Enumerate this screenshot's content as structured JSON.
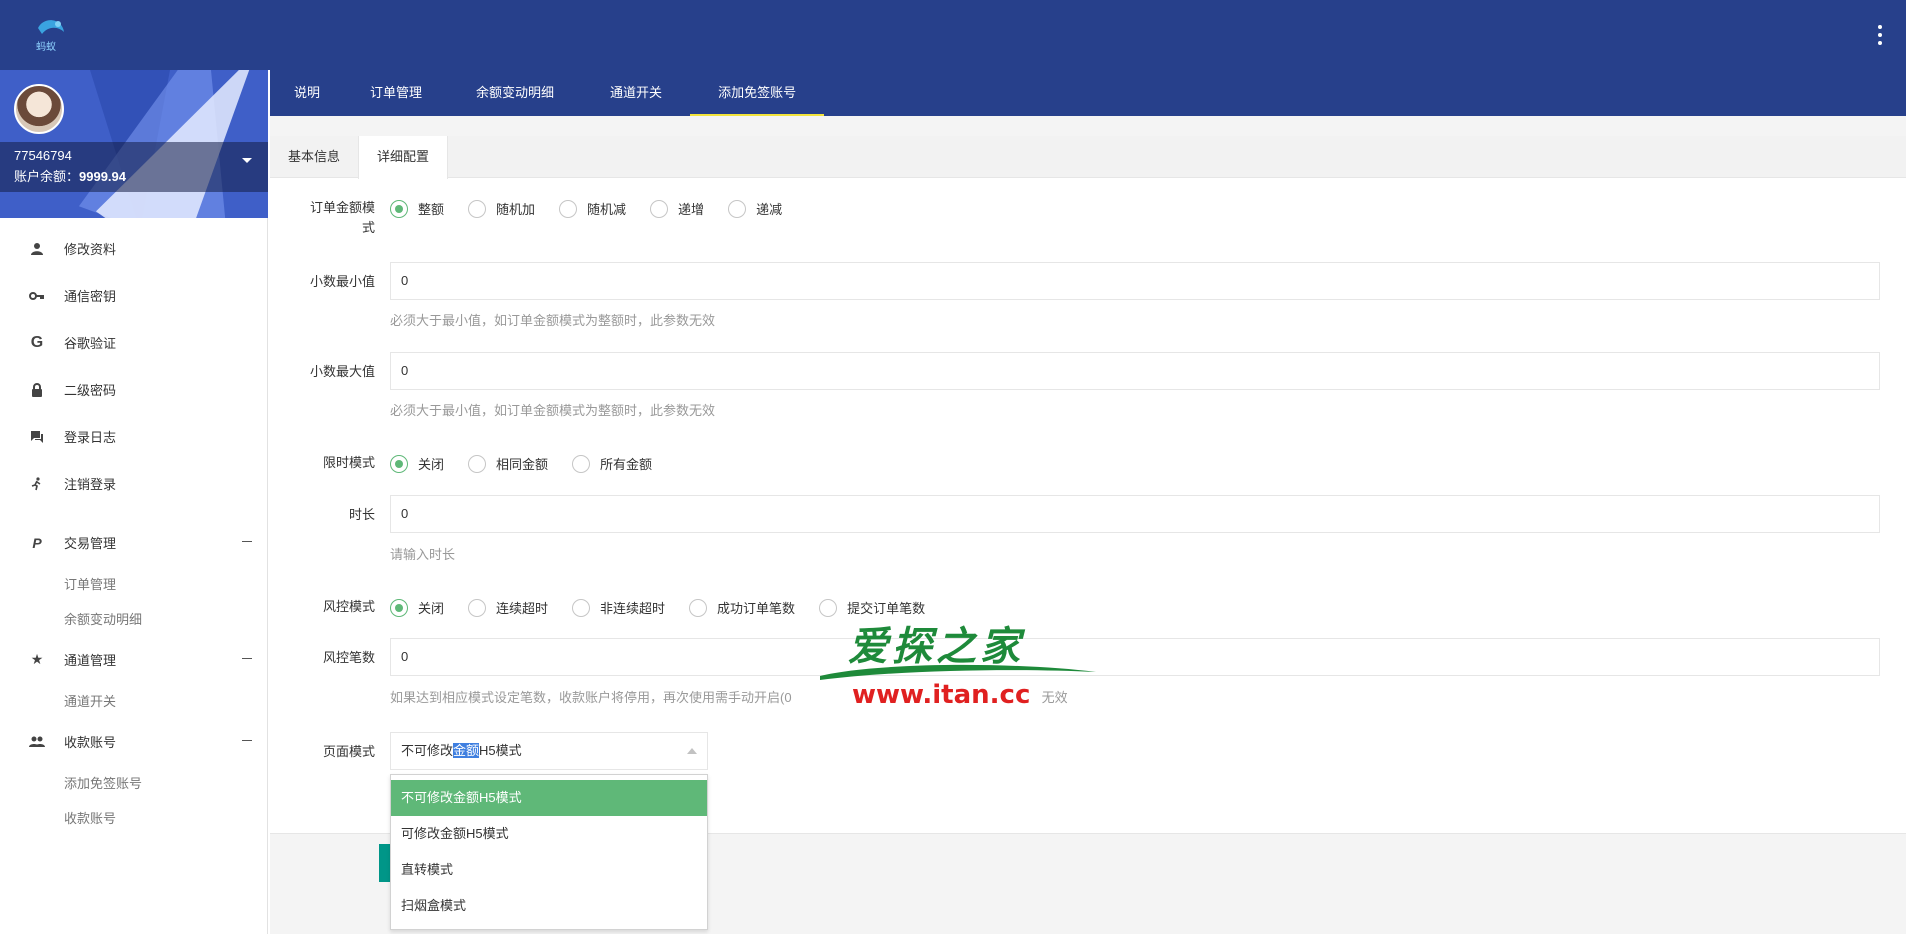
{
  "topbar": {
    "logo_text": "蚂蚁"
  },
  "sidebar": {
    "account_id": "77546794",
    "balance_label": "账户余额：",
    "balance_value": "9999.94",
    "items": [
      {
        "label": "修改资料",
        "icon": "user-icon"
      },
      {
        "label": "通信密钥",
        "icon": "key-icon"
      },
      {
        "label": "谷歌验证",
        "icon": "google-icon"
      },
      {
        "label": "二级密码",
        "icon": "lock-icon"
      },
      {
        "label": "登录日志",
        "icon": "chat-icon"
      },
      {
        "label": "注销登录",
        "icon": "logout-icon"
      }
    ],
    "groups": [
      {
        "label": "交易管理",
        "icon": "paypal-icon",
        "subs": [
          "订单管理",
          "余额变动明细"
        ]
      },
      {
        "label": "通道管理",
        "icon": "star-icon",
        "subs": [
          "通道开关"
        ]
      },
      {
        "label": "收款账号",
        "icon": "people-icon",
        "subs": [
          "添加免签账号",
          "收款账号"
        ]
      }
    ]
  },
  "nav": {
    "tabs": [
      "说明",
      "订单管理",
      "余额变动明细",
      "通道开关",
      "添加免签账号"
    ],
    "active": "添加免签账号"
  },
  "subtabs": {
    "basic": "基本信息",
    "detail": "详细配置"
  },
  "form": {
    "amount_mode": {
      "label_line1": "订单金额模",
      "label_line2": "式",
      "options": [
        "整额",
        "随机加",
        "随机减",
        "递增",
        "递减"
      ],
      "selected": "整额"
    },
    "decimal_min": {
      "label": "小数最小值",
      "value": "0",
      "hint": "必须大于最小值，如订单金额模式为整额时，此参数无效"
    },
    "decimal_max": {
      "label": "小数最大值",
      "value": "0",
      "hint": "必须大于最小值，如订单金额模式为整额时，此参数无效"
    },
    "time_mode": {
      "label": "限时模式",
      "options": [
        "关闭",
        "相同金额",
        "所有金额"
      ],
      "selected": "关闭"
    },
    "duration": {
      "label": "时长",
      "value": "0",
      "hint": "请输入时长"
    },
    "risk_mode": {
      "label": "风控模式",
      "options": [
        "关闭",
        "连续超时",
        "非连续超时",
        "成功订单笔数",
        "提交订单笔数"
      ],
      "selected": "关闭"
    },
    "risk_count": {
      "label": "风控笔数",
      "value": "0",
      "hint_left": "如果达到相应模式设定笔数，收款账户将停用，再次使用需手动开启(0",
      "hint_right": "无效"
    },
    "page_mode": {
      "label": "页面模式",
      "value_pre": "不可修改",
      "value_hl": "金额",
      "value_post": "H5模式",
      "options": [
        "不可修改金额H5模式",
        "可修改金额H5模式",
        "直转模式",
        "扫烟盒模式"
      ],
      "selected": "不可修改金额H5模式"
    }
  },
  "watermark": {
    "title": "爱探之家",
    "url": "www.itan.cc"
  },
  "colors": {
    "primary": "#27408b",
    "accent": "#5fb878",
    "tab_underline": "#f2e33c"
  }
}
